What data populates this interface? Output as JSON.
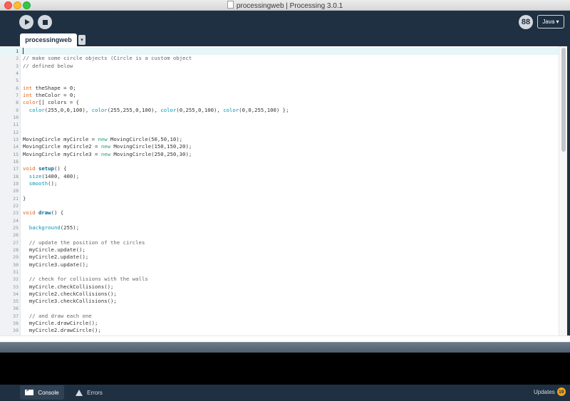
{
  "window": {
    "title": "processingweb | Processing 3.0.1"
  },
  "toolbar": {
    "mode_label": "Java ▾",
    "debug_glyph": "88"
  },
  "tabs": [
    {
      "label": "processingweb",
      "menu_glyph": "▾"
    }
  ],
  "editor": {
    "current_line": 1,
    "lines": [
      {
        "n": "1",
        "t": []
      },
      {
        "n": "2",
        "t": [
          [
            "cm",
            "// make some circle objects (Circle is a custom object"
          ]
        ]
      },
      {
        "n": "3",
        "t": [
          [
            "cm",
            "// defined below"
          ]
        ]
      },
      {
        "n": "4",
        "t": []
      },
      {
        "n": "5",
        "t": []
      },
      {
        "n": "6",
        "t": [
          [
            "kw",
            "int"
          ],
          [
            "plain",
            " theShape = 0;"
          ]
        ]
      },
      {
        "n": "7",
        "t": [
          [
            "kw",
            "int"
          ],
          [
            "plain",
            " theColor = 0;"
          ]
        ]
      },
      {
        "n": "8",
        "t": [
          [
            "kw",
            "color"
          ],
          [
            "plain",
            "[] colors = {"
          ]
        ]
      },
      {
        "n": "9",
        "t": [
          [
            "plain",
            "  "
          ],
          [
            "fn",
            "color"
          ],
          [
            "plain",
            "(255,0,0,100), "
          ],
          [
            "fn",
            "color"
          ],
          [
            "plain",
            "(255,255,0,100), "
          ],
          [
            "fn",
            "color"
          ],
          [
            "plain",
            "(0,255,0,100), "
          ],
          [
            "fn",
            "color"
          ],
          [
            "plain",
            "(0,0,255,100) };"
          ]
        ]
      },
      {
        "n": "10",
        "t": []
      },
      {
        "n": "11",
        "t": []
      },
      {
        "n": "12",
        "t": []
      },
      {
        "n": "13",
        "t": [
          [
            "plain",
            "MovingCircle myCircle = "
          ],
          [
            "new",
            "new"
          ],
          [
            "plain",
            " MovingCircle(50,50,10);"
          ]
        ]
      },
      {
        "n": "14",
        "t": [
          [
            "plain",
            "MovingCircle myCircle2 = "
          ],
          [
            "new",
            "new"
          ],
          [
            "plain",
            " MovingCircle(150,150,20);"
          ]
        ]
      },
      {
        "n": "15",
        "t": [
          [
            "plain",
            "MovingCircle myCircle3 = "
          ],
          [
            "new",
            "new"
          ],
          [
            "plain",
            " MovingCircle(250,250,30);"
          ]
        ]
      },
      {
        "n": "16",
        "t": []
      },
      {
        "n": "17",
        "t": [
          [
            "kw",
            "void"
          ],
          [
            "plain",
            " "
          ],
          [
            "fnb",
            "setup"
          ],
          [
            "plain",
            "() {"
          ]
        ]
      },
      {
        "n": "18",
        "t": [
          [
            "plain",
            "  "
          ],
          [
            "fn",
            "size"
          ],
          [
            "plain",
            "(1400, 400);"
          ]
        ]
      },
      {
        "n": "19",
        "t": [
          [
            "plain",
            "  "
          ],
          [
            "fn",
            "smooth"
          ],
          [
            "plain",
            "();"
          ]
        ]
      },
      {
        "n": "20",
        "t": []
      },
      {
        "n": "21",
        "t": [
          [
            "plain",
            "}"
          ]
        ]
      },
      {
        "n": "22",
        "t": []
      },
      {
        "n": "23",
        "t": [
          [
            "kw",
            "void"
          ],
          [
            "plain",
            " "
          ],
          [
            "fnb",
            "draw"
          ],
          [
            "plain",
            "() {"
          ]
        ]
      },
      {
        "n": "24",
        "t": []
      },
      {
        "n": "25",
        "t": [
          [
            "plain",
            "  "
          ],
          [
            "fn",
            "background"
          ],
          [
            "plain",
            "(255);"
          ]
        ]
      },
      {
        "n": "26",
        "t": []
      },
      {
        "n": "27",
        "t": [
          [
            "plain",
            "  "
          ],
          [
            "cm",
            "// update the position of the circles"
          ]
        ]
      },
      {
        "n": "28",
        "t": [
          [
            "plain",
            "  myCircle.update();"
          ]
        ]
      },
      {
        "n": "29",
        "t": [
          [
            "plain",
            "  myCircle2.update();"
          ]
        ]
      },
      {
        "n": "30",
        "t": [
          [
            "plain",
            "  myCircle3.update();"
          ]
        ]
      },
      {
        "n": "31",
        "t": []
      },
      {
        "n": "32",
        "t": [
          [
            "plain",
            "  "
          ],
          [
            "cm",
            "// check for collisions with the walls"
          ]
        ]
      },
      {
        "n": "33",
        "t": [
          [
            "plain",
            "  myCircle.checkCollisions();"
          ]
        ]
      },
      {
        "n": "34",
        "t": [
          [
            "plain",
            "  myCircle2.checkCollisions();"
          ]
        ]
      },
      {
        "n": "35",
        "t": [
          [
            "plain",
            "  myCircle3.checkCollisions();"
          ]
        ]
      },
      {
        "n": "36",
        "t": []
      },
      {
        "n": "37",
        "t": [
          [
            "plain",
            "  "
          ],
          [
            "cm",
            "// and draw each one"
          ]
        ]
      },
      {
        "n": "38",
        "t": [
          [
            "plain",
            "  myCircle.drawCircle();"
          ]
        ]
      },
      {
        "n": "39",
        "t": [
          [
            "plain",
            "  myCircle2.drawCircle();"
          ]
        ]
      }
    ]
  },
  "footer": {
    "console_label": "Console",
    "errors_label": "Errors",
    "updates_label": "Updates",
    "updates_count": "19"
  },
  "colors": {
    "chrome": "#1f3042",
    "keyword": "#e2661a",
    "function": "#0096b3",
    "comment": "#666666",
    "new_keyword": "#33997e",
    "badge": "#f3a21a"
  }
}
